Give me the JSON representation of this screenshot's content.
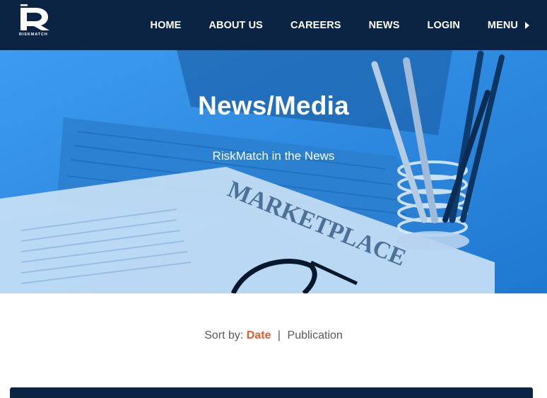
{
  "brand": {
    "logo_letter": "R",
    "logo_text": "RISKMATCH"
  },
  "nav": {
    "items": [
      {
        "label": "HOME"
      },
      {
        "label": "ABOUT US"
      },
      {
        "label": "CAREERS"
      },
      {
        "label": "NEWS"
      },
      {
        "label": "LOGIN"
      },
      {
        "label": "MENU",
        "icon": "caret-right-icon"
      }
    ]
  },
  "hero": {
    "title": "News/Media",
    "subtitle": "RiskMatch in the News",
    "image_text": "MARKETPLACE"
  },
  "sort": {
    "prefix": "Sort by:",
    "options": [
      {
        "label": "Date",
        "active": true
      },
      {
        "label": "Publication",
        "active": false
      }
    ],
    "separator": "|"
  },
  "colors": {
    "navy": "#0c2444",
    "hero_blue": "#2f8fe3",
    "accent_orange": "#e8592b",
    "text_gray": "#595959"
  }
}
